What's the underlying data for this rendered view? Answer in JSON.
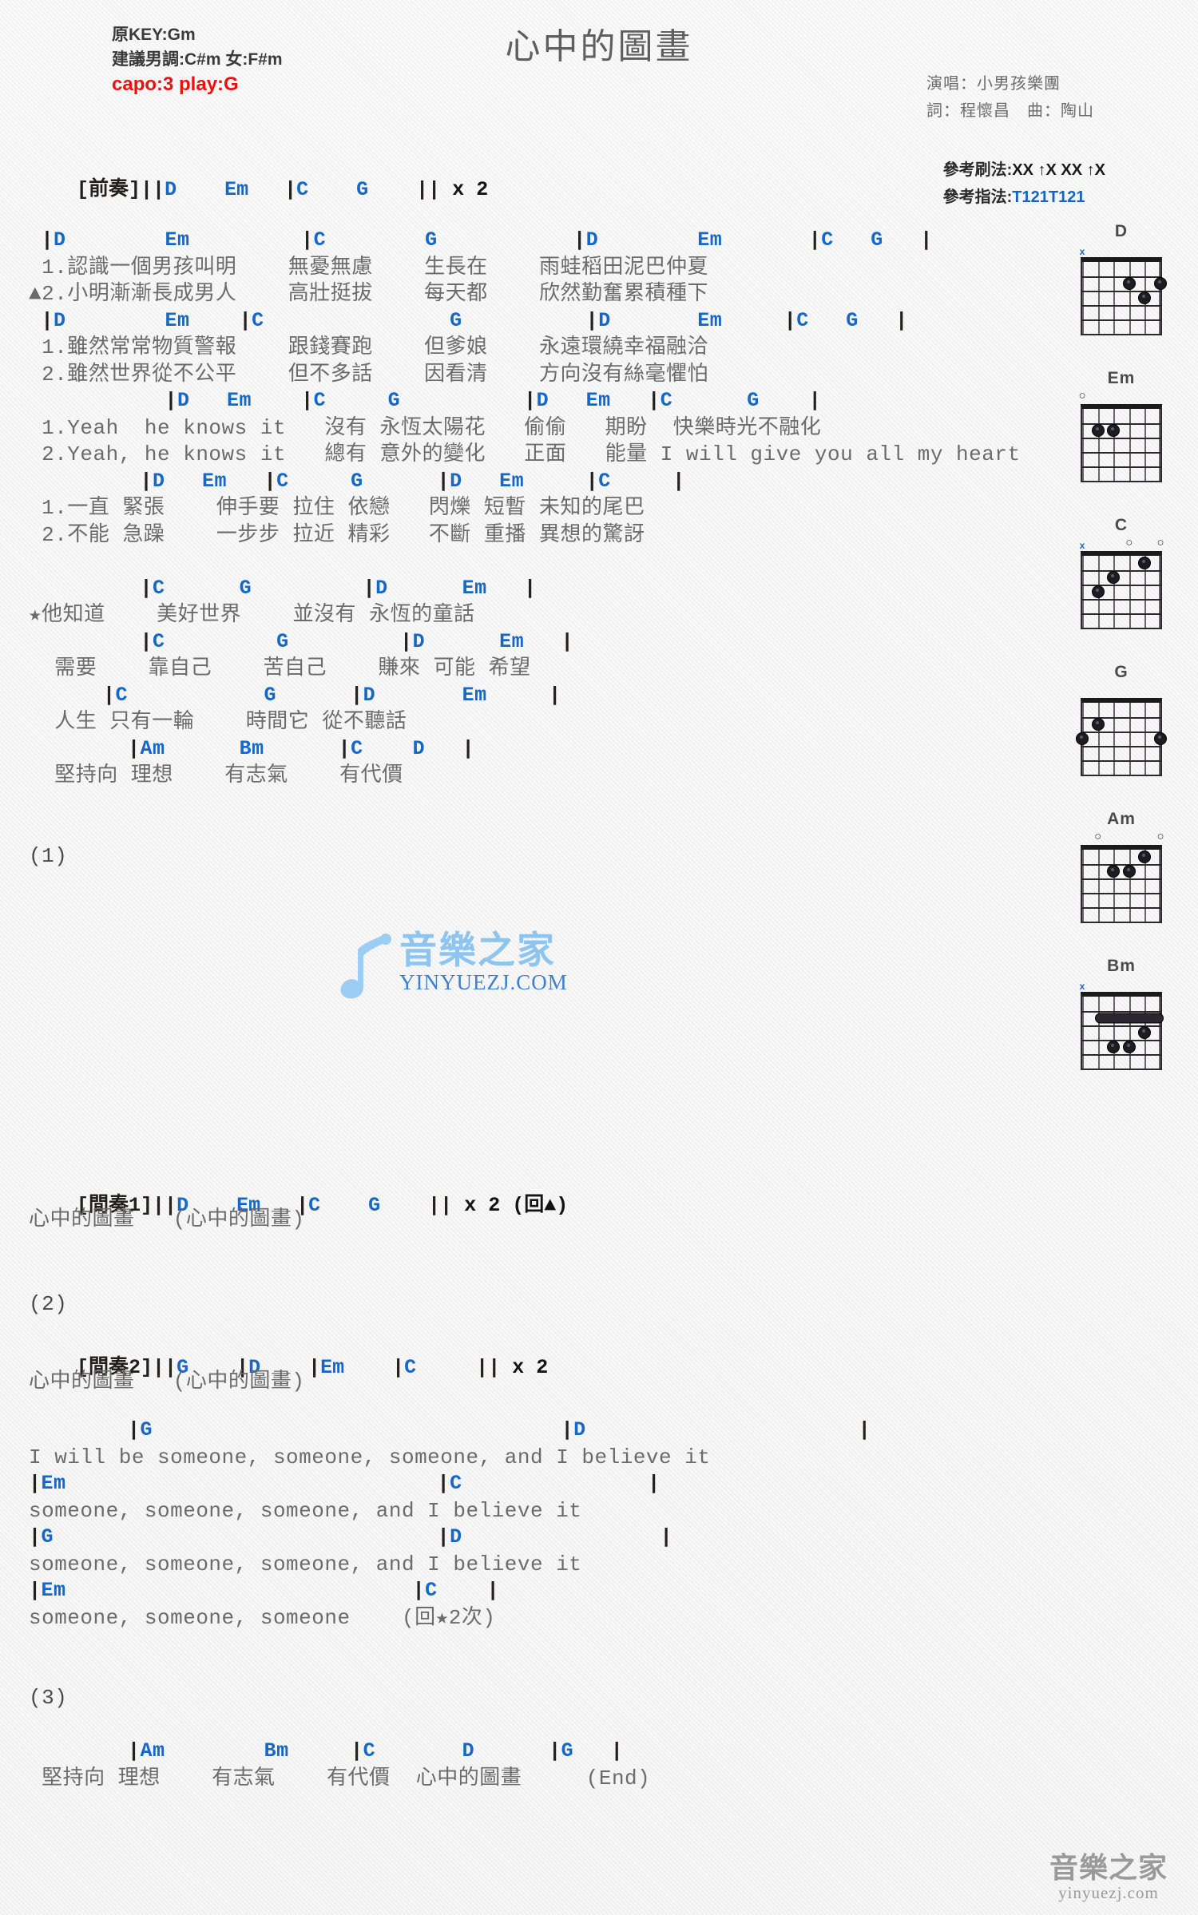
{
  "header": {
    "title": "心中的圖畫",
    "orig_key": "原KEY:Gm",
    "suggest_key": "建議男調:C#m 女:F#m",
    "capo": "capo:3 play:G",
    "singer": "演唱：小男孩樂團",
    "writer": "詞：程懷昌　曲：陶山",
    "strum_label": "參考刷法:",
    "strum_value": "XX ↑X XX ↑X",
    "finger_label": "參考指法:",
    "finger_value": "T121T121"
  },
  "intro": {
    "label": "[前奏]",
    "chords": "||D    Em   |C    G    || x 2"
  },
  "body_lines": [
    {
      "type": "chord",
      "text": " |D        Em         |C        G           |D        Em       |C   G   |"
    },
    {
      "type": "lyric",
      "text": " 1.認識一個男孩叫明    無憂無慮    生長在    雨蛙稻田泥巴仲夏"
    },
    {
      "type": "lyric",
      "text": "▲2.小明漸漸長成男人    高壯挺拔    每天都    欣然勤奮累積種下"
    },
    {
      "type": "chord",
      "text": " |D        Em    |C               G          |D       Em     |C   G   |"
    },
    {
      "type": "lyric",
      "text": " 1.雖然常常物質警報    跟錢賽跑    但爹娘    永遠環繞幸福融洽"
    },
    {
      "type": "lyric",
      "text": " 2.雖然世界從不公平    但不多話    因看清    方向沒有絲毫懼怕"
    },
    {
      "type": "chord",
      "text": "           |D   Em    |C     G          |D   Em   |C      G    |"
    },
    {
      "type": "lyric",
      "text": " 1.Yeah  he knows it   沒有 永恆太陽花   偷偷   期盼  快樂時光不融化"
    },
    {
      "type": "lyric",
      "text": " 2.Yeah, he knows it   總有 意外的變化   正面   能量 I will give you all my heart"
    },
    {
      "type": "chord",
      "text": "         |D   Em   |C     G      |D   Em     |C     |"
    },
    {
      "type": "lyric",
      "text": " 1.一直 緊張    伸手要 拉住 依戀   閃爍 短暫 未知的尾巴"
    },
    {
      "type": "lyric",
      "text": " 2.不能 急躁    一步步 拉近 精彩   不斷 重播 異想的驚訝"
    },
    {
      "type": "blank",
      "text": " "
    },
    {
      "type": "chord",
      "text": "         |C      G         |D      Em   |"
    },
    {
      "type": "lyric",
      "text": "★他知道    美好世界    並沒有 永恆的童話"
    },
    {
      "type": "chord",
      "text": "         |C         G         |D      Em   |"
    },
    {
      "type": "lyric",
      "text": "  需要    靠自己    苦自己    賺來 可能 希望"
    },
    {
      "type": "chord",
      "text": "      |C           G      |D       Em     |"
    },
    {
      "type": "lyric",
      "text": "  人生 只有一輪    時間它 從不聽話"
    },
    {
      "type": "chord",
      "text": "        |Am      Bm      |C    D   |"
    },
    {
      "type": "lyric",
      "text": "  堅持向 理想    有志氣    有代價"
    },
    {
      "type": "blank",
      "text": " "
    },
    {
      "type": "blank",
      "text": " "
    },
    {
      "type": "marker",
      "text": "(1)"
    }
  ],
  "interlude1": {
    "label": "[間奏1]",
    "chords": "||D    Em   |C    G    || x 2",
    "repeat": " (回▲)",
    "lyric": "心中的圖畫   (心中的圖畫)"
  },
  "marker2": "(2)",
  "interlude2": {
    "label": "[間奏2]",
    "chords": "||G    |D    |Em    |C     || x 2",
    "lyric": "心中的圖畫   (心中的圖畫)"
  },
  "bridge_lines": [
    {
      "type": "chord",
      "text": "        |G                                 |D                      |"
    },
    {
      "type": "lyric",
      "text": "I will be someone, someone, someone, and I believe it"
    },
    {
      "type": "chord",
      "text": "|Em                              |C               |"
    },
    {
      "type": "lyric",
      "text": "someone, someone, someone, and I believe it"
    },
    {
      "type": "chord",
      "text": "|G                               |D                |"
    },
    {
      "type": "lyric",
      "text": "someone, someone, someone, and I believe it"
    },
    {
      "type": "chord",
      "text": "|Em                            |C    |"
    },
    {
      "type": "lyric",
      "text": "someone, someone, someone    (回★2次)"
    },
    {
      "type": "blank",
      "text": " "
    },
    {
      "type": "blank",
      "text": " "
    },
    {
      "type": "marker",
      "text": "(3)"
    },
    {
      "type": "blank",
      "text": " "
    },
    {
      "type": "chord",
      "text": "        |Am        Bm     |C       D      |G   |"
    },
    {
      "type": "lyric",
      "text": " 堅持向 理想    有志氣    有代價  心中的圖畫     (End)"
    }
  ],
  "chord_diagrams": [
    {
      "name": "D",
      "markers": [
        {
          "sym": "x",
          "string": 6
        }
      ],
      "dots": [
        {
          "string": 3,
          "fret": 2
        },
        {
          "string": 1,
          "fret": 2
        },
        {
          "string": 2,
          "fret": 3
        }
      ],
      "barre": null
    },
    {
      "name": "Em",
      "markers": [
        {
          "sym": "o",
          "string": 6
        }
      ],
      "dots": [
        {
          "string": 5,
          "fret": 2
        },
        {
          "string": 4,
          "fret": 2
        }
      ],
      "barre": null
    },
    {
      "name": "C",
      "markers": [
        {
          "sym": "x",
          "string": 6
        },
        {
          "sym": "o",
          "string": 3
        },
        {
          "sym": "o",
          "string": 1
        }
      ],
      "dots": [
        {
          "string": 2,
          "fret": 1
        },
        {
          "string": 4,
          "fret": 2
        },
        {
          "string": 5,
          "fret": 3
        }
      ],
      "barre": null
    },
    {
      "name": "G",
      "markers": [],
      "dots": [
        {
          "string": 5,
          "fret": 2
        },
        {
          "string": 6,
          "fret": 3
        },
        {
          "string": 1,
          "fret": 3
        }
      ],
      "barre": null
    },
    {
      "name": "Am",
      "markers": [
        {
          "sym": "o",
          "string": 5
        },
        {
          "sym": "o",
          "string": 1
        }
      ],
      "dots": [
        {
          "string": 2,
          "fret": 1
        },
        {
          "string": 4,
          "fret": 2
        },
        {
          "string": 3,
          "fret": 2
        }
      ],
      "barre": null
    },
    {
      "name": "Bm",
      "markers": [
        {
          "sym": "x",
          "string": 6
        }
      ],
      "dots": [
        {
          "string": 2,
          "fret": 3
        },
        {
          "string": 4,
          "fret": 4
        },
        {
          "string": 3,
          "fret": 4
        }
      ],
      "barre": {
        "fret": 2,
        "from": 5,
        "to": 1
      }
    }
  ],
  "watermark": {
    "logo": "音樂之家",
    "url": "YINYUEZJ.COM",
    "bottom_logo": "音樂之家",
    "bottom_url": "yinyuezj.com"
  }
}
